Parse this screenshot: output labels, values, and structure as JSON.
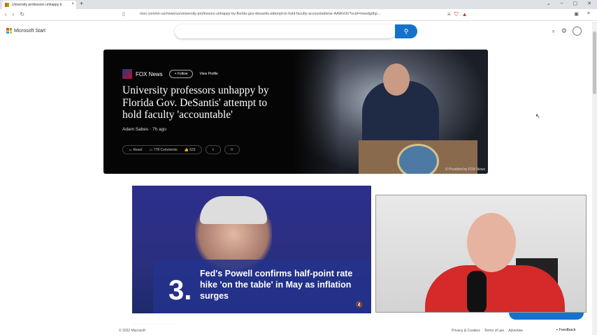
{
  "browser": {
    "tab_title": "University professors unhappy b",
    "url": "msn.com/en-us/news/us/university-professors-unhappy-by-florida-gov-desantis-attempt-to-hold-faculty-accountable/ar-AAWvOn?ocid=msedgdhp..."
  },
  "header": {
    "logo": "Microsoft Start",
    "search_placeholder": ""
  },
  "hero": {
    "source": "FOX News",
    "follow": "+ Follow",
    "view_profile": "View Profile",
    "title": "University professors unhappy by Florida Gov. DeSantis' attempt to hold faculty 'accountable'",
    "byline": "Adam Sabes · 7h ago",
    "react": "React",
    "comments": "778 Comments",
    "reactions": "623",
    "credit": "© Provided by FOX News"
  },
  "card": {
    "number": "3.",
    "title": "Fed's Powell confirms half-point rate hike 'on the table' in May as inflation surges"
  },
  "footer": {
    "copyright": "© 2022 Microsoft",
    "links": [
      "Privacy & Cookies",
      "Terms of use",
      "Advertise"
    ],
    "feedback": "Feedback"
  }
}
